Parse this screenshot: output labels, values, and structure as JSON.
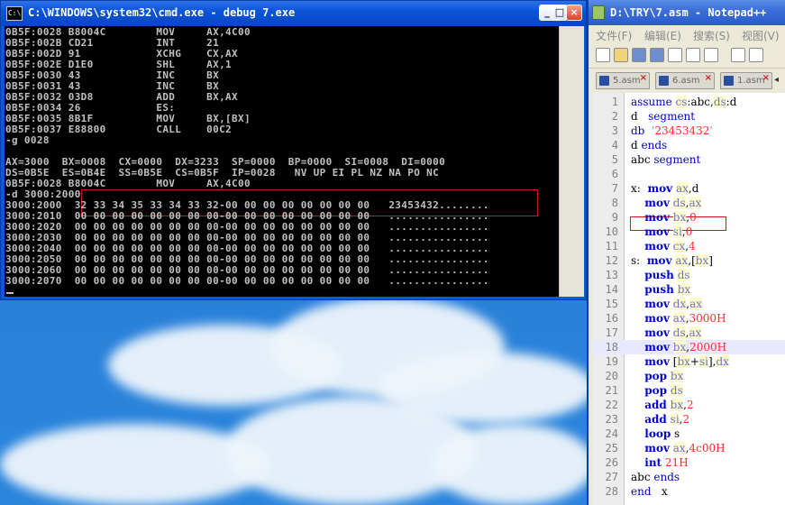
{
  "cmd": {
    "title": "C:\\WINDOWS\\system32\\cmd.exe - debug 7.exe",
    "icon_label": "C:\\",
    "lines": [
      "0B5F:0028 B8004C        MOV     AX,4C00",
      "0B5F:002B CD21          INT     21",
      "0B5F:002D 91            XCHG    CX,AX",
      "0B5F:002E D1E0          SHL     AX,1",
      "0B5F:0030 43            INC     BX",
      "0B5F:0031 43            INC     BX",
      "0B5F:0032 03D8          ADD     BX,AX",
      "0B5F:0034 26            ES:",
      "0B5F:0035 8B1F          MOV     BX,[BX]",
      "0B5F:0037 E88800        CALL    00C2",
      "-g 0028",
      "",
      "AX=3000  BX=0008  CX=0000  DX=3233  SP=0000  BP=0000  SI=0008  DI=0000",
      "DS=0B5E  ES=0B4E  SS=0B5E  CS=0B5F  IP=0028   NV UP EI PL NZ NA PO NC",
      "0B5F:0028 B8004C        MOV     AX,4C00",
      "-d 3000:2000",
      "3000:2000  32 33 34 35 33 34 33 32-00 00 00 00 00 00 00 00   23453432........",
      "3000:2010  00 00 00 00 00 00 00 00-00 00 00 00 00 00 00 00   ................",
      "3000:2020  00 00 00 00 00 00 00 00-00 00 00 00 00 00 00 00   ................",
      "3000:2030  00 00 00 00 00 00 00 00-00 00 00 00 00 00 00 00   ................",
      "3000:2040  00 00 00 00 00 00 00 00-00 00 00 00 00 00 00 00   ................",
      "3000:2050  00 00 00 00 00 00 00 00-00 00 00 00 00 00 00 00   ................",
      "3000:2060  00 00 00 00 00 00 00 00-00 00 00 00 00 00 00 00   ................",
      "3000:2070  00 00 00 00 00 00 00 00-00 00 00 00 00 00 00 00   ................"
    ],
    "minimize_glyph": "_",
    "maximize_glyph": "□",
    "close_glyph": "×"
  },
  "notepad": {
    "title": "D:\\TRY\\7.asm - Notepad++",
    "menu": [
      "文件(F)",
      "编辑(E)",
      "搜索(S)",
      "视图(V)"
    ],
    "tabs": [
      "5.asm",
      "6.asm",
      "1.asm"
    ],
    "highlighted_line": 18,
    "lines": [
      {
        "n": "1",
        "code": "assume cs:abc,ds:d"
      },
      {
        "n": "2",
        "code": "d   segment"
      },
      {
        "n": "3",
        "code": "db  '23453432'"
      },
      {
        "n": "4",
        "code": "d ends"
      },
      {
        "n": "5",
        "code": "abc segment"
      },
      {
        "n": "6",
        "code": ""
      },
      {
        "n": "7",
        "code": "x:  mov ax,d"
      },
      {
        "n": "8",
        "code": "    mov ds,ax"
      },
      {
        "n": "9",
        "code": "    mov bx,0"
      },
      {
        "n": "10",
        "code": "    mov si,0"
      },
      {
        "n": "11",
        "code": "    mov cx,4"
      },
      {
        "n": "12",
        "code": "s:  mov ax,[bx]"
      },
      {
        "n": "13",
        "code": "    push ds"
      },
      {
        "n": "14",
        "code": "    push bx"
      },
      {
        "n": "15",
        "code": "    mov dx,ax"
      },
      {
        "n": "16",
        "code": "    mov ax,3000H"
      },
      {
        "n": "17",
        "code": "    mov ds,ax"
      },
      {
        "n": "18",
        "code": "    mov bx,2000H"
      },
      {
        "n": "19",
        "code": "    mov [bx+si],dx"
      },
      {
        "n": "20",
        "code": "    pop bx"
      },
      {
        "n": "21",
        "code": "    pop ds"
      },
      {
        "n": "22",
        "code": "    add bx,2"
      },
      {
        "n": "23",
        "code": "    add si,2"
      },
      {
        "n": "24",
        "code": "    loop s"
      },
      {
        "n": "25",
        "code": "    mov ax,4c00H"
      },
      {
        "n": "26",
        "code": "    int 21H"
      },
      {
        "n": "27",
        "code": "abc ends"
      },
      {
        "n": "28",
        "code": "end   x"
      }
    ]
  }
}
